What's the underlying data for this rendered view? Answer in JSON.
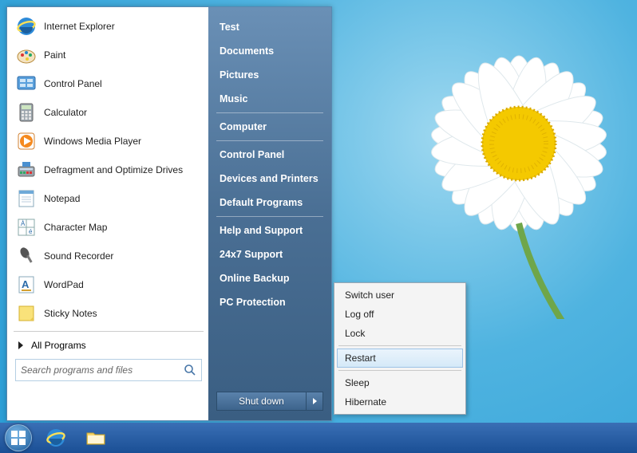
{
  "programs": [
    {
      "label": "Internet Explorer",
      "icon": "ie"
    },
    {
      "label": "Paint",
      "icon": "paint"
    },
    {
      "label": "Control Panel",
      "icon": "cpanel"
    },
    {
      "label": "Calculator",
      "icon": "calc"
    },
    {
      "label": "Windows Media Player",
      "icon": "wmp"
    },
    {
      "label": "Defragment and Optimize Drives",
      "icon": "defrag"
    },
    {
      "label": "Notepad",
      "icon": "notepad"
    },
    {
      "label": "Character Map",
      "icon": "charmap"
    },
    {
      "label": "Sound Recorder",
      "icon": "mic"
    },
    {
      "label": "WordPad",
      "icon": "wordpad"
    },
    {
      "label": "Sticky Notes",
      "icon": "sticky"
    }
  ],
  "all_programs_label": "All Programs",
  "search": {
    "placeholder": "Search programs and files"
  },
  "right_groups": [
    [
      "Test",
      "Documents",
      "Pictures",
      "Music"
    ],
    [
      "Computer"
    ],
    [
      "Control Panel",
      "Devices and Printers",
      "Default Programs"
    ],
    [
      "Help and Support",
      "24x7 Support",
      "Online Backup",
      "PC Protection"
    ]
  ],
  "shutdown_label": "Shut down",
  "power_menu": {
    "groups": [
      [
        "Switch user",
        "Log off",
        "Lock"
      ],
      [
        "Restart"
      ],
      [
        "Sleep",
        "Hibernate"
      ]
    ],
    "highlighted": "Restart"
  },
  "taskbar_icons": [
    "start",
    "ie",
    "explorer"
  ]
}
